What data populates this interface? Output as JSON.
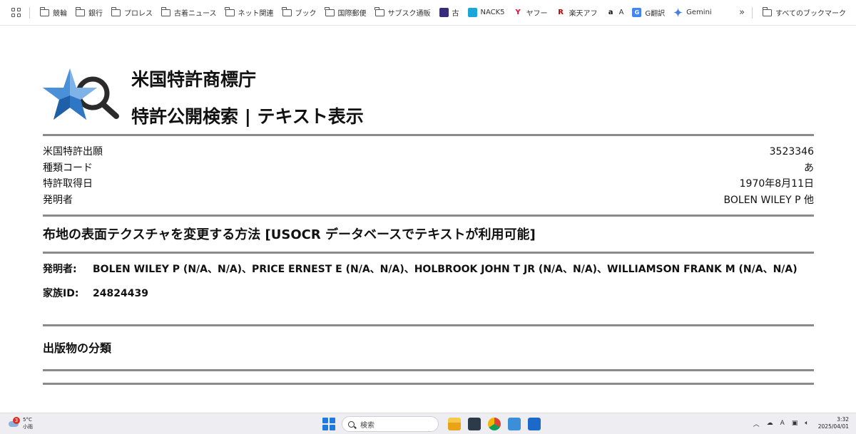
{
  "bookmarks": {
    "items": [
      {
        "label": "競輪",
        "icon": "folder-icon"
      },
      {
        "label": "銀行",
        "icon": "folder-icon"
      },
      {
        "label": "プロレス",
        "icon": "folder-icon"
      },
      {
        "label": "古着ニュース",
        "icon": "folder-icon"
      },
      {
        "label": "ネット関連",
        "icon": "folder-icon"
      },
      {
        "label": "ブック",
        "icon": "folder-icon"
      },
      {
        "label": "国際郵便",
        "icon": "folder-icon"
      },
      {
        "label": "サブスク通販",
        "icon": "folder-icon"
      },
      {
        "label": "古",
        "icon": "site-favicon"
      },
      {
        "label": "NACK5",
        "icon": "nack5-favicon"
      },
      {
        "label": "ヤフー",
        "icon": "yahoo-favicon"
      },
      {
        "label": "楽天アフ",
        "icon": "rakuten-favicon"
      },
      {
        "label": "A",
        "icon": "amazon-favicon"
      },
      {
        "label": "G翻訳",
        "icon": "google-translate-favicon"
      },
      {
        "label": "Gemini",
        "icon": "gemini-favicon"
      }
    ],
    "more": "»",
    "all_bookmarks": "すべてのブックマーク"
  },
  "header": {
    "title_line1": "米国特許商標庁",
    "title_line2": "特許公開検索 | テキスト表示"
  },
  "meta": [
    {
      "label": "米国特許出願",
      "value": "3523346"
    },
    {
      "label": "種類コード",
      "value": "あ"
    },
    {
      "label": "特許取得日",
      "value": "1970年8月11日"
    },
    {
      "label": "発明者",
      "value": "BOLEN WILEY P 他"
    }
  ],
  "document": {
    "title": "布地の表面テクスチャを変更する方法 [USOCR データベースでテキストが利用可能]",
    "inventors_label": "発明者:",
    "inventors_value": "BOLEN WILEY P (N/A、N/A)、PRICE ERNEST E (N/A、N/A)、HOLBROOK JOHN T JR (N/A、N/A)、WILLIAMSON FRANK M (N/A、N/A)",
    "family_label": "家族ID:",
    "family_value": "24824439",
    "classification_title": "出版物の分類"
  },
  "taskbar": {
    "weather_temp": "5°C",
    "weather_desc": "小雨",
    "weather_badge": "3",
    "search_placeholder": "検索",
    "ime": "A",
    "time": "3:32",
    "date": "2025/04/01"
  },
  "colors": {
    "logo_blue_light": "#4a90d9",
    "logo_blue_dark": "#1f5fa8",
    "logo_dark": "#2b2b2b",
    "rule": "#8a8a8a"
  }
}
